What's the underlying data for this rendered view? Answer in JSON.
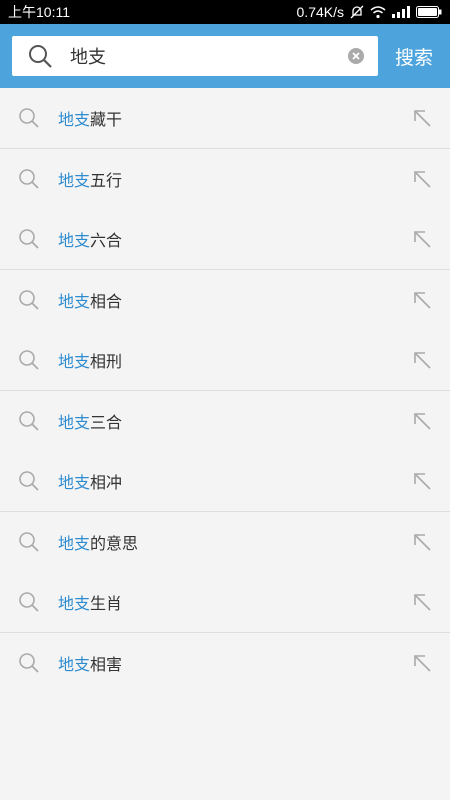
{
  "status_bar": {
    "time": "上午10:11",
    "network_speed": "0.74K/s"
  },
  "search": {
    "query": "地支",
    "button_label": "搜索"
  },
  "suggestions": [
    {
      "highlight": "地支",
      "rest": "藏干"
    },
    {
      "highlight": "地支",
      "rest": "五行"
    },
    {
      "highlight": "地支",
      "rest": "六合"
    },
    {
      "highlight": "地支",
      "rest": "相合"
    },
    {
      "highlight": "地支",
      "rest": "相刑"
    },
    {
      "highlight": "地支",
      "rest": "三合"
    },
    {
      "highlight": "地支",
      "rest": "相冲"
    },
    {
      "highlight": "地支",
      "rest": "的意思"
    },
    {
      "highlight": "地支",
      "rest": "生肖"
    },
    {
      "highlight": "地支",
      "rest": "相害"
    }
  ],
  "colors": {
    "accent": "#4da3dc",
    "highlight": "#2d8bd0",
    "background": "#f4f4f4"
  }
}
